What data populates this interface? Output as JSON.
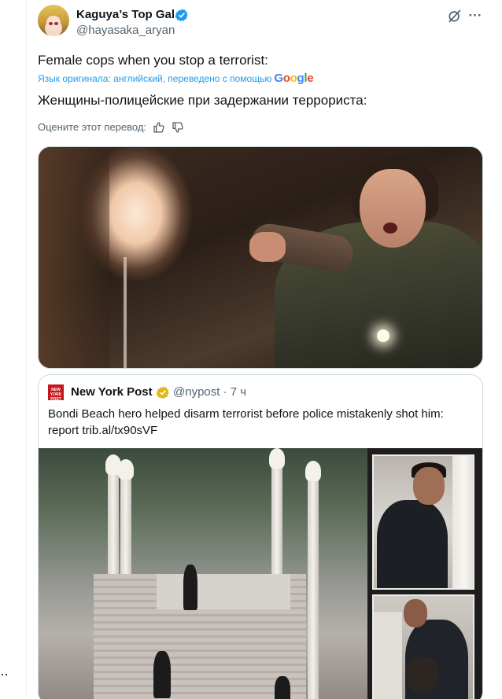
{
  "author": {
    "name": "Kaguya’s Top Gal",
    "handle": "@hayasaka_aryan"
  },
  "tweet": {
    "text": "Female cops when you stop a terrorist:",
    "translation_note": "Язык оригинала: английский, переведено с помощью",
    "translation_provider_letters": [
      "G",
      "o",
      "o",
      "g",
      "l",
      "e"
    ],
    "translated_text": "Женщины-полицейские при задержании террориста:",
    "rate_prompt": "Оцените этот перевод:"
  },
  "quoted": {
    "name": "New York Post",
    "handle_time": "@nypost · 7 ч",
    "logo_text": "NEW YORK POST",
    "text": "Bondi Beach hero helped disarm terrorist before police mistakenly shot him: report trib.al/tx90sVF"
  },
  "icons": {
    "more": "more-icon",
    "grok": "grok-icon",
    "verified": "verified-badge-icon",
    "thumbs_up": "thumbs-up-icon",
    "thumbs_down": "thumbs-down-icon"
  },
  "colors": {
    "link_blue": "#1d9bf0",
    "verified_blue": "#1d9bf0",
    "verified_gold": "#e2b719",
    "nypost_red": "#c4161c",
    "secondary_text": "#536471"
  }
}
